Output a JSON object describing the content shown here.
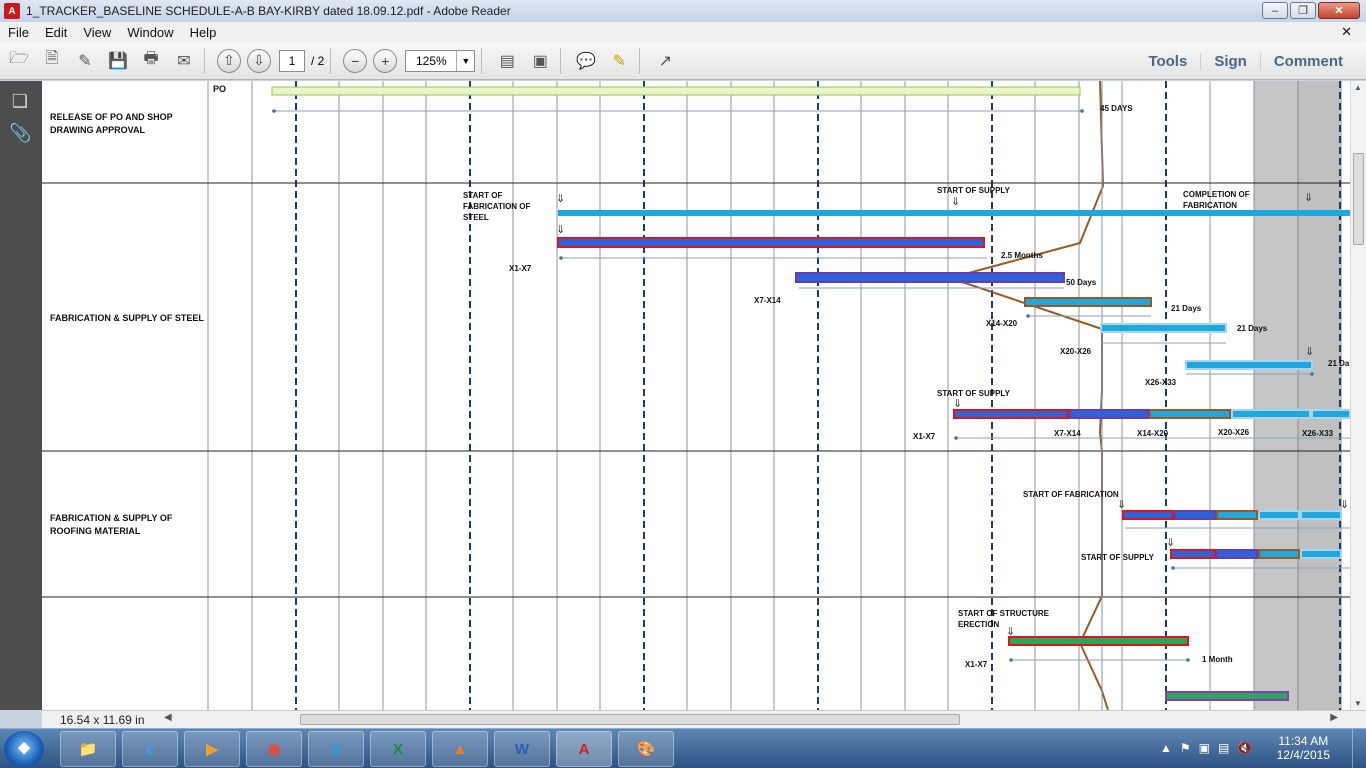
{
  "window": {
    "title": "1_TRACKER_BASELINE SCHEDULE-A-B BAY-KIRBY dated 18.09.12.pdf - Adobe Reader"
  },
  "menu": [
    "File",
    "Edit",
    "View",
    "Window",
    "Help"
  ],
  "toolbar": {
    "page_current": "1",
    "page_total": "/ 2",
    "zoom": "125%",
    "tools": "Tools",
    "sign": "Sign",
    "comment": "Comment"
  },
  "status": {
    "page_size": "16.54 x 11.69 in"
  },
  "clock": {
    "time": "11:34 AM",
    "date": "12/4/2015"
  },
  "colors": {
    "red_outline": "#e0141b",
    "blue_fill": "#2e63d8",
    "brown_outline": "#9a5a23",
    "cyan": "#1fa8e0",
    "green_bar": "#2aa55a",
    "lime_bar": "#e9f5c6",
    "dashed_line": "#1c3b73",
    "shade": "#c6c6c6"
  },
  "schedule": {
    "rows": [
      {
        "label_1": "RELEASE OF PO AND SHOP",
        "label_2": "DRAWING APPROVAL"
      },
      {
        "label_1": "FABRICATION & SUPPLY OF STEEL"
      },
      {
        "label_1": "FABRICATION & SUPPLY OF",
        "label_2": "ROOFING MATERIAL"
      }
    ],
    "sub_row_label": "PO",
    "annotations": {
      "days_45": "45 DAYS",
      "start_fab_1": "START OF",
      "start_fab_2": "FABRICATION OF",
      "start_fab_3": "STEEL",
      "start_supply": "START OF SUPPLY",
      "completion_1": "COMPLETION OF",
      "completion_2": "FABRICATION",
      "months_2_5": "2.5 Months",
      "days_50": "50 Days",
      "days_21": "21 Days",
      "days_21_cut": "21 Da",
      "start_fabrication": "START OF FABRICATION",
      "start_erect_1": "START OF STRUCTURE",
      "start_erect_2": "ERECTION",
      "month_1": "1 Month",
      "x1_x7": "X1-X7",
      "x7_x14": "X7-X14",
      "x14_x20": "X14-X20",
      "x20_x26": "X20-X26",
      "x26_x33": "X26-X33"
    }
  }
}
